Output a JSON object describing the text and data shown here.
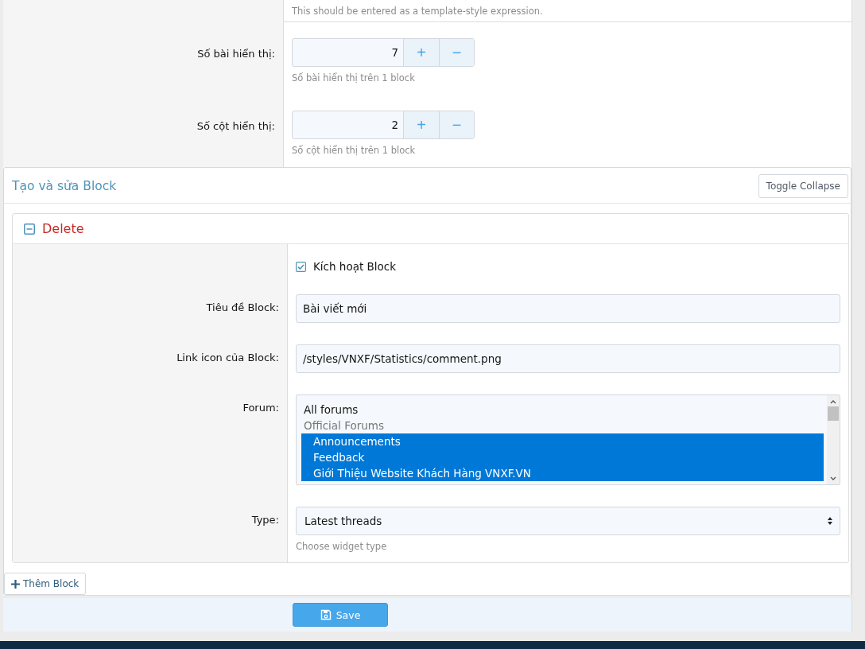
{
  "top_hint": "This should be entered as a template-style expression.",
  "spinners": [
    {
      "label": "Số bài hiển thị:",
      "value": "7",
      "plus": "+",
      "minus": "−",
      "hint": "Số bài hiển thị trên 1 block"
    },
    {
      "label": "Số cột hiển thị:",
      "value": "2",
      "plus": "+",
      "minus": "−",
      "hint": "Số cột hiển thị trên 1 block"
    }
  ],
  "block_panel": {
    "title": "Tạo và sửa Block",
    "toggle_button": "Toggle Collapse",
    "block": {
      "title": "Delete",
      "expanded": true,
      "enable": {
        "label": "Kích hoạt Block",
        "checked": true
      },
      "title_field": {
        "label": "Tiêu đề Block:",
        "value": "Bài viết mới"
      },
      "icon_field": {
        "label": "Link icon của Block:",
        "value": "/styles/VNXF/Statistics/comment.png"
      },
      "forum": {
        "label": "Forum:",
        "options": [
          {
            "text": "All forums",
            "kind": "option",
            "selected": false
          },
          {
            "text": "Official Forums",
            "kind": "group",
            "selected": false
          },
          {
            "text": "Announcements",
            "kind": "option",
            "selected": true
          },
          {
            "text": "Feedback",
            "kind": "option",
            "selected": true
          },
          {
            "text": "Giới Thiệu Website Khách Hàng VNXF.VN",
            "kind": "option",
            "selected": true
          }
        ]
      },
      "type": {
        "label": "Type:",
        "value": "Latest threads",
        "hint": "Choose widget type"
      }
    },
    "add_button": "Thêm Block"
  },
  "save_button": "Save"
}
